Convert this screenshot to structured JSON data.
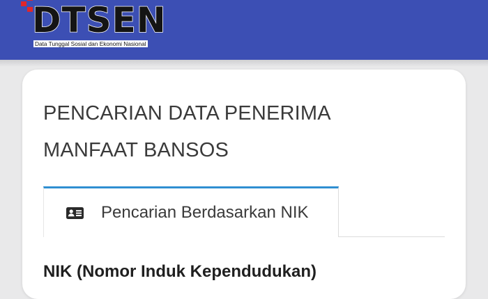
{
  "header": {
    "logo_text": "DTSEN",
    "tagline": "Data Tunggal Sosial dan Ekonomi Nasional",
    "background_color": "#3c4fb4",
    "logo_accent_color": "#e0262b"
  },
  "card": {
    "title_line1": "PENCARIAN DATA PENERIMA",
    "title_line2": "MANFAAT BANSOS"
  },
  "tabs": [
    {
      "label": "Pencarian Berdasarkan NIK",
      "icon": "id-card-icon",
      "active": true,
      "accent_color": "#2f8fd1"
    }
  ],
  "form": {
    "nik_label": "NIK (Nomor Induk Kependudukan)"
  }
}
